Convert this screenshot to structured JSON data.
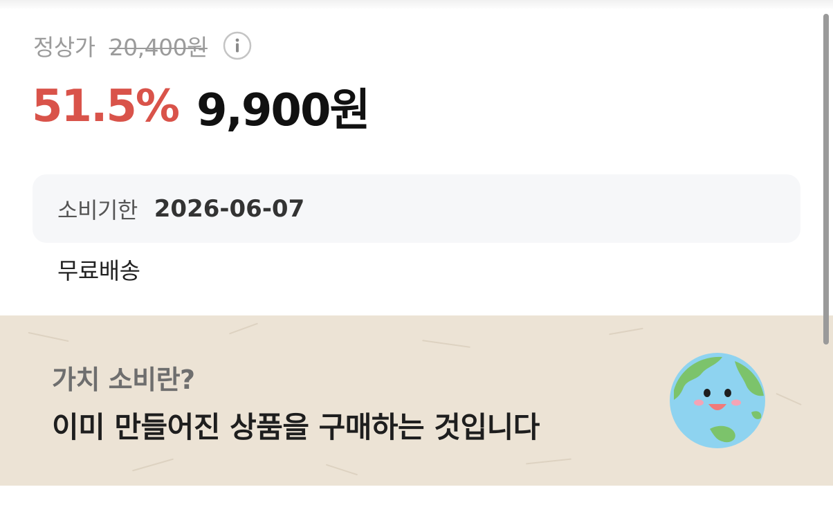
{
  "pricing": {
    "regular_label": "정상가",
    "regular_price": "20,400원",
    "discount_rate": "51.5%",
    "sale_price": "9,900원"
  },
  "details": {
    "expiry_label": "소비기한",
    "expiry_date": "2026-06-07",
    "shipping_text": "무료배송"
  },
  "banner": {
    "question": "가치 소비란?",
    "answer": "이미 만들어진 상품을 구매하는 것입니다",
    "icon": "smiling-earth-icon"
  },
  "icons": {
    "info": "info-icon"
  },
  "colors": {
    "discount": "#d9534a",
    "banner_bg": "#ece3d5",
    "earth_ocean": "#8ed3f0",
    "earth_land": "#7cc36b"
  }
}
